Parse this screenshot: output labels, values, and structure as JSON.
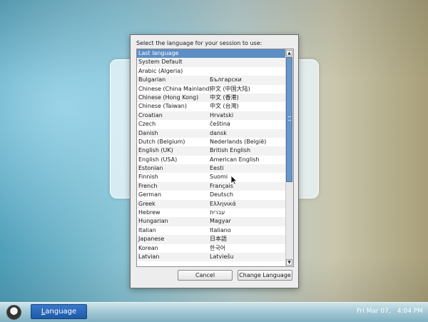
{
  "dialog": {
    "prompt": "Select the language for your session to use:",
    "languages": [
      {
        "name": "Last language",
        "native": ""
      },
      {
        "name": "System Default",
        "native": ""
      },
      {
        "name": "Arabic (Algeria)",
        "native": ""
      },
      {
        "name": "Bulgarian",
        "native": "Български"
      },
      {
        "name": "Chinese (China Mainland)",
        "native": "中文 (中国大陆)"
      },
      {
        "name": "Chinese (Hong Kong)",
        "native": "中文 (香港)"
      },
      {
        "name": "Chinese (Taiwan)",
        "native": "中文 (台灣)"
      },
      {
        "name": "Croatian",
        "native": "Hrvatski"
      },
      {
        "name": "Czech",
        "native": "čeština"
      },
      {
        "name": "Danish",
        "native": "dansk"
      },
      {
        "name": "Dutch (Belgium)",
        "native": "Nederlands (België)"
      },
      {
        "name": "English (UK)",
        "native": "British English"
      },
      {
        "name": "English (USA)",
        "native": "American English"
      },
      {
        "name": "Estonian",
        "native": "Eesti"
      },
      {
        "name": "Finnish",
        "native": "Suomi"
      },
      {
        "name": "French",
        "native": "Français"
      },
      {
        "name": "German",
        "native": "Deutsch"
      },
      {
        "name": "Greek",
        "native": "Ελληνικά"
      },
      {
        "name": "Hebrew",
        "native": "עברית"
      },
      {
        "name": "Hungarian",
        "native": "Magyar"
      },
      {
        "name": "Italian",
        "native": "Italiano"
      },
      {
        "name": "Japanese",
        "native": "日本語"
      },
      {
        "name": "Korean",
        "native": "한국어"
      },
      {
        "name": "Latvian",
        "native": "Latviešu"
      }
    ],
    "selected_index": 0,
    "cancel_label": "Cancel",
    "change_label": "Change Language"
  },
  "taskbar": {
    "language_button_underlined": "L",
    "language_button_rest": "anguage",
    "date": "Fri Mar 07,",
    "time": "4:04 PM"
  },
  "colors": {
    "selection": "#5d8ec4",
    "taskbar_button": "#1e5aa8"
  },
  "icons": {
    "avatar": "user-avatar-icon",
    "scroll_up": "scroll-up-arrow-icon",
    "scroll_down": "scroll-down-arrow-icon",
    "pointer": "mouse-pointer-icon"
  }
}
